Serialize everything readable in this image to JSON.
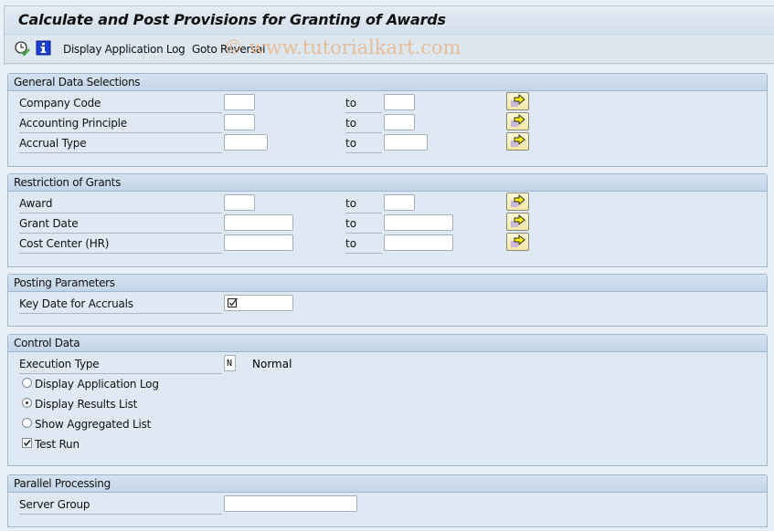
{
  "window": {
    "title": "Calculate and Post Provisions for Granting of Awards"
  },
  "toolbar": {
    "icons": [
      "execute-clock-icon",
      "info-icon"
    ],
    "display_log_label": "Display Application Log",
    "goto_reversal_label": "Goto Reversal"
  },
  "watermark": "© www.tutorialkart.com",
  "groups": {
    "general": {
      "title": "General Data Selections",
      "rows": [
        {
          "label": "Company Code",
          "from": "",
          "to_label": "to",
          "to": ""
        },
        {
          "label": "Accounting Principle",
          "from": "",
          "to_label": "to",
          "to": ""
        },
        {
          "label": "Accrual Type",
          "from": "",
          "to_label": "to",
          "to": ""
        }
      ]
    },
    "restriction": {
      "title": "Restriction of Grants",
      "rows": [
        {
          "label": "Award",
          "from": "",
          "to_label": "to",
          "to": ""
        },
        {
          "label": "Grant Date",
          "from": "",
          "to_label": "to",
          "to": ""
        },
        {
          "label": "Cost Center (HR)",
          "from": "",
          "to_label": "to",
          "to": ""
        }
      ]
    },
    "posting": {
      "title": "Posting Parameters",
      "key_date_label": "Key Date for Accruals",
      "key_date_value": "",
      "key_date_required": true
    },
    "control": {
      "title": "Control Data",
      "execution_type_label": "Execution Type",
      "execution_type_value": "N",
      "execution_type_text": "Normal",
      "options": [
        {
          "label": "Display Application Log",
          "selected": false
        },
        {
          "label": "Display Results List",
          "selected": true
        },
        {
          "label": "Show Aggregated List",
          "selected": false
        }
      ],
      "test_run_label": "Test Run",
      "test_run_checked": true
    },
    "parallel": {
      "title": "Parallel Processing",
      "server_group_label": "Server Group",
      "server_group_value": ""
    }
  },
  "colors": {
    "background": "#e9eff6",
    "group_header": "#c3d5e8",
    "multi_select_button": "#f3e6a6",
    "watermark": "#e9b98e"
  }
}
